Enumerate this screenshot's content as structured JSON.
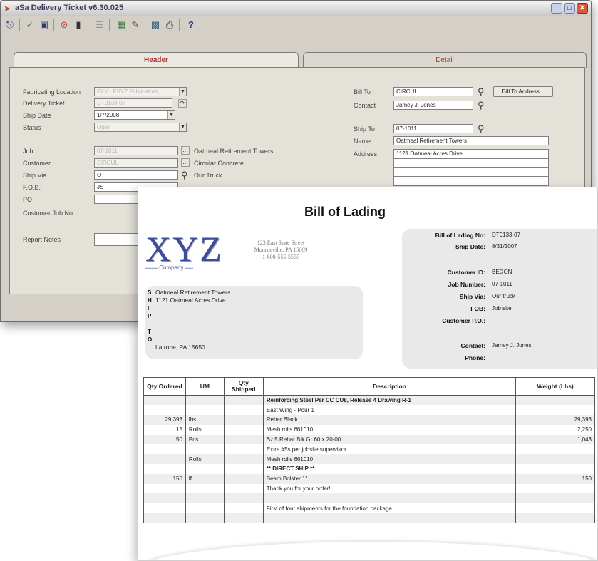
{
  "window": {
    "title": "aSa Delivery Ticket v6.30.025",
    "tabs": {
      "header": "Header",
      "detail": "Detail"
    }
  },
  "form": {
    "fabricating_location": {
      "label": "Fabricating Location",
      "value": "FXY - FXYZ Fabricators"
    },
    "delivery_ticket": {
      "label": "Delivery Ticket",
      "value": "DT0133-07"
    },
    "ship_date": {
      "label": "Ship Date",
      "value": "1/7/2008"
    },
    "status": {
      "label": "Status",
      "value": "Open"
    },
    "job": {
      "label": "Job",
      "value": "07-1011",
      "desc": "Oatmeal Retirement Towers"
    },
    "customer": {
      "label": "Customer",
      "value": "CIRCUL",
      "desc": "Circular Concrete"
    },
    "ship_via": {
      "label": "Ship Via",
      "value": "OT",
      "desc": "Our Truck"
    },
    "fob": {
      "label": "F.O.B.",
      "value": "JS"
    },
    "po": {
      "label": "PO",
      "value": ""
    },
    "customer_job_no": {
      "label": "Customer Job No",
      "value": ""
    },
    "report_notes": {
      "label": "Report Notes",
      "value": ""
    },
    "bill_to": {
      "label": "Bill To",
      "value": "CIRCUL",
      "button": "Bill To Address..."
    },
    "contact": {
      "label": "Contact",
      "value": "Jamey J. Jones"
    },
    "ship_to": {
      "label": "Ship To",
      "value": "07-1011"
    },
    "name": {
      "label": "Name",
      "value": "Oatmeal Retirement Towers"
    },
    "address": {
      "label": "Address",
      "value": "1121 Oatmeal Acres Drive"
    }
  },
  "doc": {
    "title": "Bill of Lading",
    "logo_text": "XYZ",
    "logo_sub": "Company",
    "company_address": [
      "123 East State Street",
      "Monroeville, PA 15669",
      "1-800-555-5555"
    ],
    "ship_to_letters": [
      "S",
      "H",
      "I",
      "P",
      "",
      "T",
      "O"
    ],
    "ship_to_lines": [
      "Oatmeal Retirement Towers",
      "1121 Oatmeal Acres Drive",
      "Latrobe, PA 15650"
    ],
    "info": {
      "bol_no": {
        "label": "Bill of Lading No:",
        "value": "DT0133-07"
      },
      "ship_date": {
        "label": "Ship Date:",
        "value": "8/31/2007"
      },
      "customer_id": {
        "label": "Customer ID:",
        "value": "BECON"
      },
      "job_number": {
        "label": "Job Number:",
        "value": "07-1011"
      },
      "ship_via": {
        "label": "Ship Via:",
        "value": "Our truck"
      },
      "fob": {
        "label": "FOB:",
        "value": "Job site"
      },
      "customer_po": {
        "label": "Customer P.O.:",
        "value": ""
      },
      "contact": {
        "label": "Contact:",
        "value": "Jamey J. Jones"
      },
      "phone": {
        "label": "Phone:",
        "value": ""
      }
    },
    "table": {
      "headers": {
        "qty_ordered": "Qty Ordered",
        "um": "UM",
        "qty_shipped": "Qty Shipped",
        "description": "Description",
        "weight": "Weight (Lbs)"
      },
      "rows": [
        [
          "",
          "",
          "",
          "Reinforcing Steel Per CC CU8, Release 4 Drawing R-1",
          ""
        ],
        [
          "",
          "",
          "",
          "East Wing - Pour 1",
          ""
        ],
        [
          "29,393",
          "lbs",
          "",
          "Rebar Black",
          "29,393"
        ],
        [
          "15",
          "Rolls",
          "",
          "Mesh rolls 661010",
          "2,250"
        ],
        [
          "50",
          "Pcs",
          "",
          "Sz 5 Rebar Blk Gr 60 x 20-00",
          "1,043"
        ],
        [
          "",
          "",
          "",
          "Extra #5s per jobsite supervisor.",
          ""
        ],
        [
          "",
          "Rolls",
          "",
          "Mesh rolls 661010",
          ""
        ],
        [
          "",
          "",
          "",
          "** DIRECT SHIP **",
          ""
        ],
        [
          "150",
          "lf",
          "",
          "Beam Bolster 1\"",
          "150"
        ],
        [
          "",
          "",
          "",
          "Thank you for your order!",
          ""
        ],
        [
          "",
          "",
          "",
          "",
          ""
        ],
        [
          "",
          "",
          "",
          "First of four shipments for the foundation package.",
          ""
        ],
        [
          "",
          "",
          "",
          "",
          ""
        ]
      ]
    }
  }
}
